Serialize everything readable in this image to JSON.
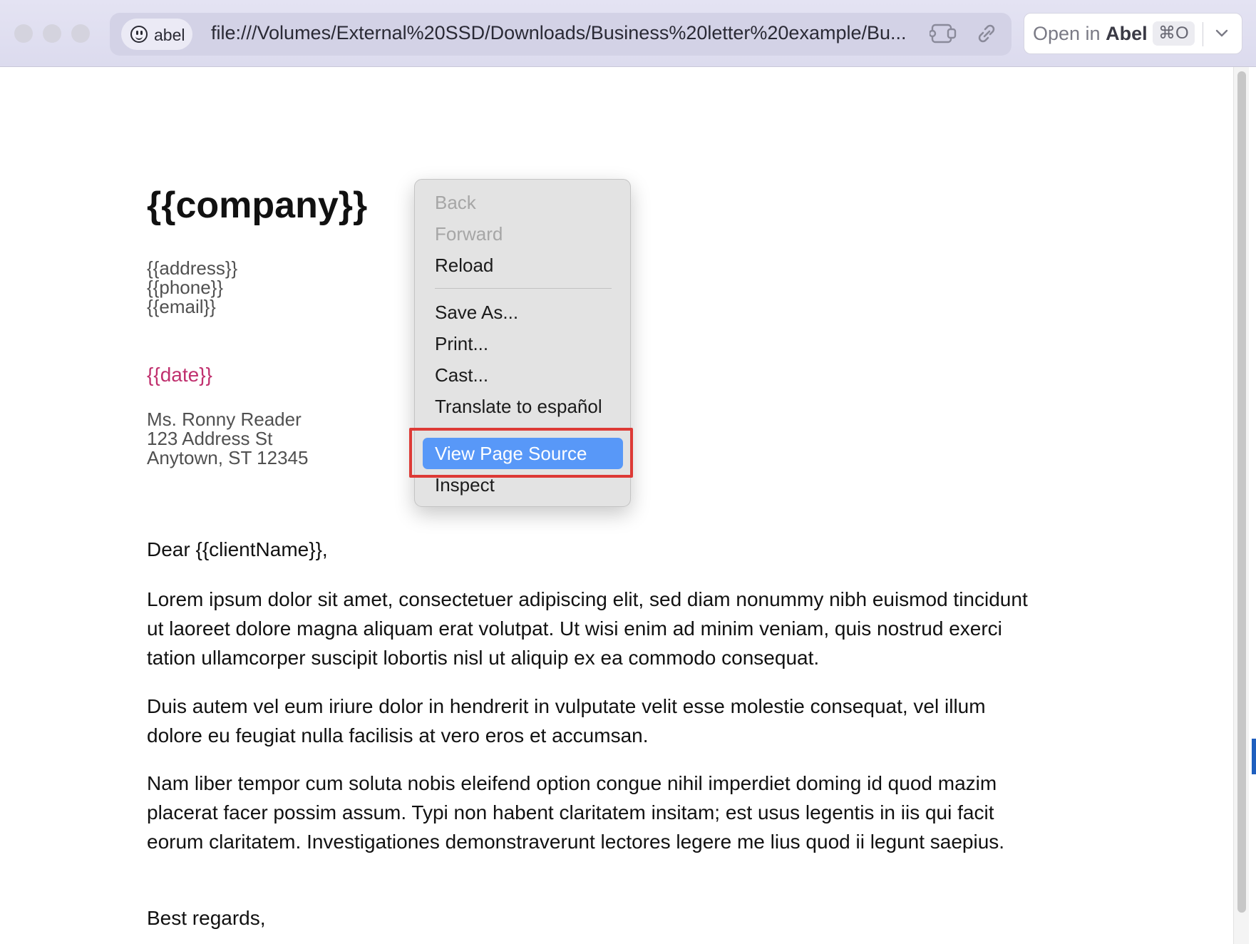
{
  "browser": {
    "profile_name": "abel",
    "url": "file:///Volumes/External%20SSD/Downloads/Business%20letter%20example/Bu...",
    "open_in_prefix": "Open in",
    "open_in_app": "Abel",
    "open_in_shortcut": "⌘O"
  },
  "letter": {
    "company": "{{company}}",
    "sender_lines": [
      "{{address}}",
      "{{phone}}",
      "{{email}}"
    ],
    "date": "{{date}}",
    "recipient_lines": [
      "Ms. Ronny Reader",
      "123 Address St",
      "Anytown, ST 12345"
    ],
    "greeting": "Dear {{clientName}},",
    "paragraphs": [
      "Lorem ipsum dolor sit amet, consectetuer adipiscing elit, sed diam nonummy nibh euismod tincidunt ut laoreet dolore magna aliquam erat volutpat. Ut wisi enim ad minim veniam, quis nostrud exerci tation ullamcorper suscipit lobortis nisl ut aliquip ex ea commodo consequat.",
      "Duis autem vel eum iriure dolor in hendrerit in vulputate velit esse molestie consequat, vel illum dolore eu feugiat nulla facilisis at vero eros et accumsan.",
      "Nam liber tempor cum soluta nobis eleifend option congue nihil imperdiet doming id quod mazim placerat facer possim assum. Typi non habent claritatem insitam; est usus legentis in iis qui facit eorum claritatem. Investigationes demonstraverunt lectores legere me lius quod ii legunt saepius."
    ],
    "closing": "Best regards,"
  },
  "context_menu": {
    "back": "Back",
    "forward": "Forward",
    "reload": "Reload",
    "save_as": "Save As...",
    "print": "Print...",
    "cast": "Cast...",
    "translate": "Translate to español",
    "view_source": "View Page Source",
    "inspect": "Inspect"
  },
  "colors": {
    "menu_highlight": "#5898f8",
    "callout": "#dd3a36",
    "date_text": "#c0306e"
  }
}
